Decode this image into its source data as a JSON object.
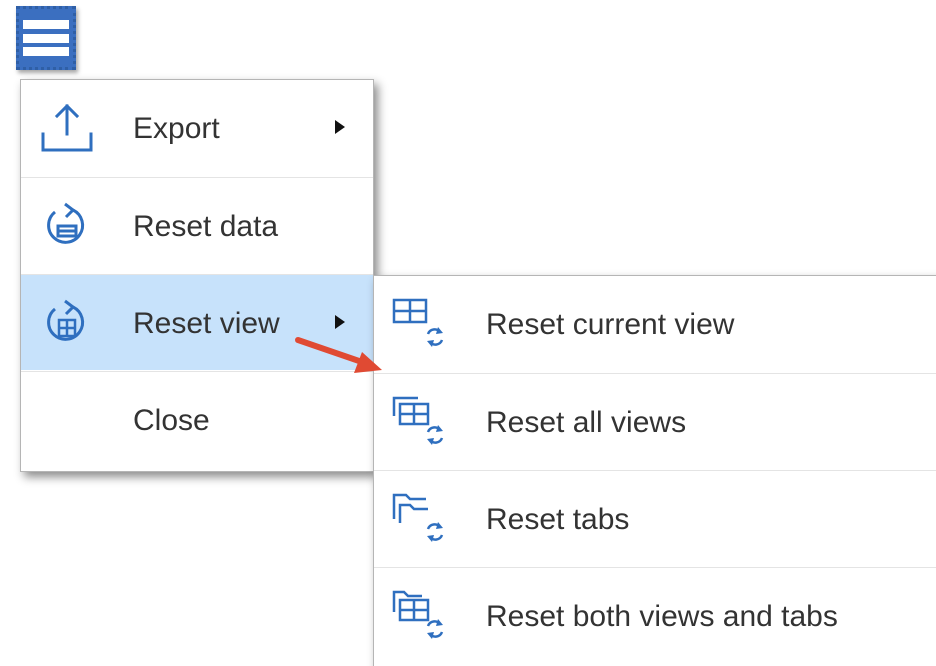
{
  "main_menu": {
    "items": [
      {
        "label": "Export",
        "icon": "export-icon",
        "has_submenu": true,
        "active": false
      },
      {
        "label": "Reset data",
        "icon": "reset-data-icon",
        "has_submenu": false,
        "active": false
      },
      {
        "label": "Reset view",
        "icon": "reset-view-icon",
        "has_submenu": true,
        "active": true
      },
      {
        "label": "Close",
        "icon": "",
        "has_submenu": false,
        "active": false
      }
    ]
  },
  "sub_menu": {
    "items": [
      {
        "label": "Reset current view",
        "icon": "reset-current-view-icon"
      },
      {
        "label": "Reset all views",
        "icon": "reset-all-views-icon"
      },
      {
        "label": "Reset tabs",
        "icon": "reset-tabs-icon"
      },
      {
        "label": "Reset both views and tabs",
        "icon": "reset-views-tabs-icon"
      }
    ]
  },
  "colors": {
    "accent": "#3b6fc0",
    "active_bg": "#c7e2fb",
    "icon": "#2f6fbf",
    "annotation_arrow": "#e04a33",
    "text": "#333333"
  }
}
